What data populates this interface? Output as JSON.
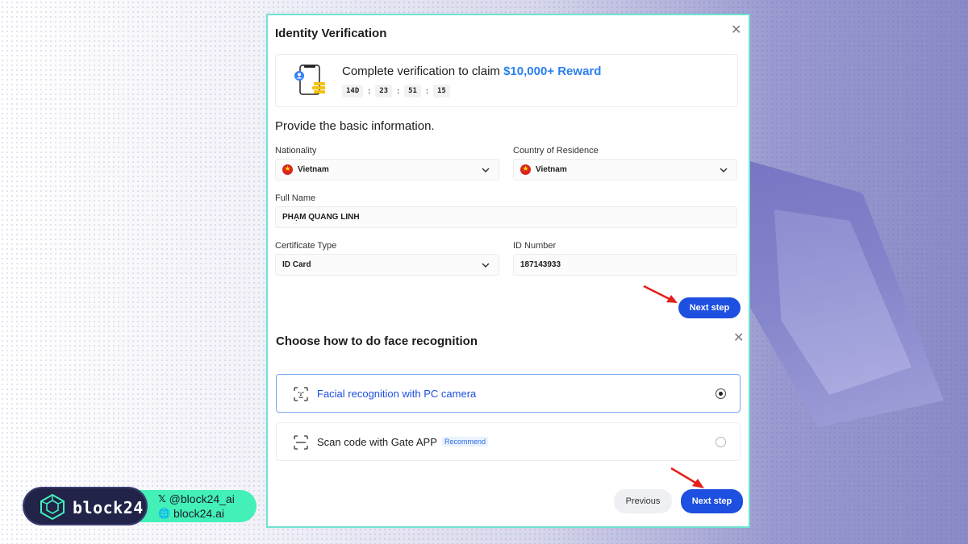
{
  "step1": {
    "title": "Identity Verification",
    "banner": {
      "text": "Complete verification to claim ",
      "reward": "$10,000+ Reward",
      "timer": [
        "14D",
        "23",
        "51",
        "15"
      ]
    },
    "heading": "Provide the basic information.",
    "fields": {
      "nationality": {
        "label": "Nationality",
        "value": "Vietnam"
      },
      "residence": {
        "label": "Country of Residence",
        "value": "Vietnam"
      },
      "full_name": {
        "label": "Full Name",
        "value": "PHẠM QUANG LINH"
      },
      "cert_type": {
        "label": "Certificate Type",
        "value": "ID Card"
      },
      "id_number": {
        "label": "ID Number",
        "value": "187143933"
      }
    },
    "next_label": "Next step"
  },
  "step2": {
    "title": "Choose how to do face recognition",
    "options": [
      {
        "label": "Facial recognition with PC camera",
        "selected": true
      },
      {
        "label": "Scan code with Gate APP",
        "tag": "Recommend",
        "selected": false
      }
    ],
    "previous_label": "Previous",
    "next_label": "Next step"
  },
  "brand": {
    "name": "block24",
    "twitter": "@block24_ai",
    "website": "block24.ai"
  },
  "colors": {
    "primary": "#1d4fe0",
    "reward": "#2b7ff0",
    "modal_border": "#6fe3cf",
    "brand_dark": "#222348",
    "brand_accent": "#42f0b8",
    "arrow": "#e3201b"
  }
}
